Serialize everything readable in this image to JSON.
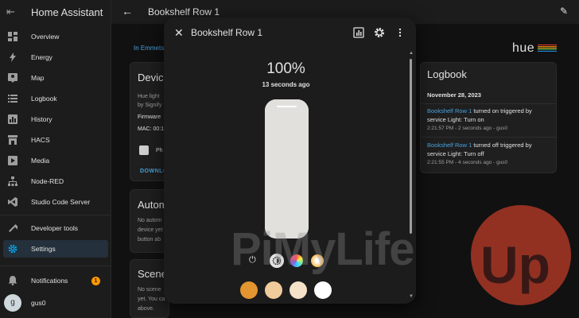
{
  "sidebar": {
    "title": "Home Assistant",
    "items": [
      {
        "label": "Overview",
        "icon": "dashboard-icon"
      },
      {
        "label": "Energy",
        "icon": "lightning-icon"
      },
      {
        "label": "Map",
        "icon": "map-icon"
      },
      {
        "label": "Logbook",
        "icon": "list-icon"
      },
      {
        "label": "History",
        "icon": "chart-icon"
      },
      {
        "label": "HACS",
        "icon": "store-icon"
      },
      {
        "label": "Media",
        "icon": "play-icon"
      },
      {
        "label": "Node-RED",
        "icon": "sitemap-icon"
      },
      {
        "label": "Studio Code Server",
        "icon": "vscode-icon"
      },
      {
        "label": "Developer tools",
        "icon": "hammer-icon"
      },
      {
        "label": "Settings",
        "icon": "gear-icon"
      }
    ],
    "notifications_label": "Notifications",
    "notifications_count": "1",
    "user_initial": "g",
    "user_name": "gus0"
  },
  "topbar": {
    "title": "Bookshelf Row 1"
  },
  "background": {
    "breadcrumb": "In Emmets",
    "device_card": {
      "heading": "Device",
      "line1": "Hue light",
      "line2": "by Signify",
      "firmware": "Firmware",
      "mac": "MAC: 00:1",
      "ph": "Ph",
      "download": "DOWNLO"
    },
    "automation_card": {
      "heading": "Autom",
      "line1": "No autom",
      "line2": "device yet",
      "line3": "button ab"
    },
    "scene_card": {
      "heading": "Scene",
      "line1": "No scene",
      "line2": "yet. You ca",
      "line3": "above."
    },
    "hue_logo": "hue",
    "logbook": {
      "heading": "Logbook",
      "date": "November 28, 2023",
      "entries": [
        {
          "entity": "Bookshelf Row 1",
          "text1": " turned on triggered by",
          "text2": "service Light: Turn on",
          "time": "2:21:57 PM - 2 seconds ago - gus0"
        },
        {
          "entity": "Bookshelf Row 1",
          "text1": " turned off triggered by",
          "text2": "service Light: Turn off",
          "time": "2:21:55 PM - 4 seconds ago - gus0"
        }
      ]
    }
  },
  "dialog": {
    "title": "Bookshelf Row 1",
    "brightness": "100%",
    "brightness_value": 1.0,
    "last_changed": "13 seconds ago",
    "swatches": [
      "#e3962f",
      "#f0cb9b",
      "#f6e2c8",
      "#ffffff"
    ]
  },
  "watermark": {
    "text": "PiMyLife",
    "up": "Up"
  },
  "colors": {
    "accent": "#03a9f4",
    "link": "#4aa3df",
    "badge": "#ff9800"
  }
}
